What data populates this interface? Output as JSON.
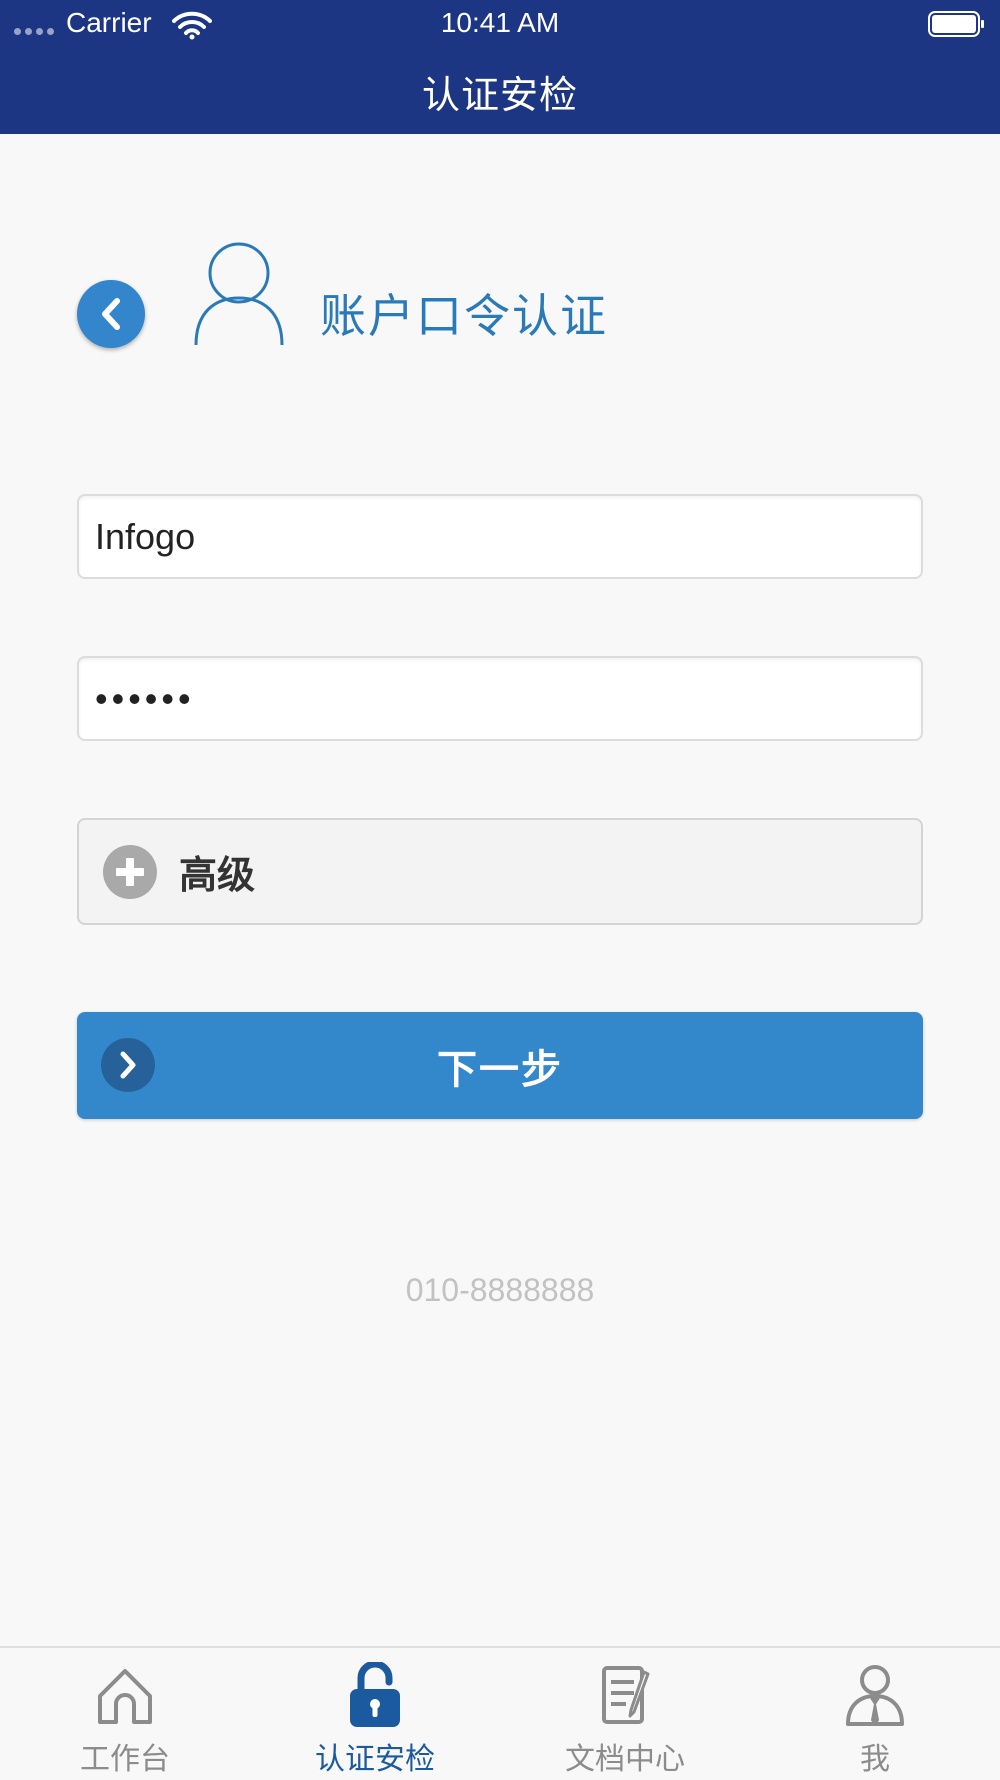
{
  "status_bar": {
    "carrier": "Carrier",
    "time": "10:41 AM"
  },
  "nav": {
    "title": "认证安检"
  },
  "auth": {
    "section_title": "账户口令认证",
    "username_value": "Infogo",
    "password_value": "123456",
    "advanced_label": "高级",
    "next_label": "下一步"
  },
  "footer": {
    "phone": "010-8888888"
  },
  "tabs": [
    {
      "label": "工作台",
      "icon": "home-icon",
      "active": false
    },
    {
      "label": "认证安检",
      "icon": "lock-icon",
      "active": true
    },
    {
      "label": "文档中心",
      "icon": "document-icon",
      "active": false
    },
    {
      "label": "我",
      "icon": "user-icon",
      "active": false
    }
  ],
  "colors": {
    "nav_background": "#1c3683",
    "accent": "#3388cb",
    "active_tab": "#1c5aa0",
    "inactive_tab": "#8c8c8c"
  }
}
